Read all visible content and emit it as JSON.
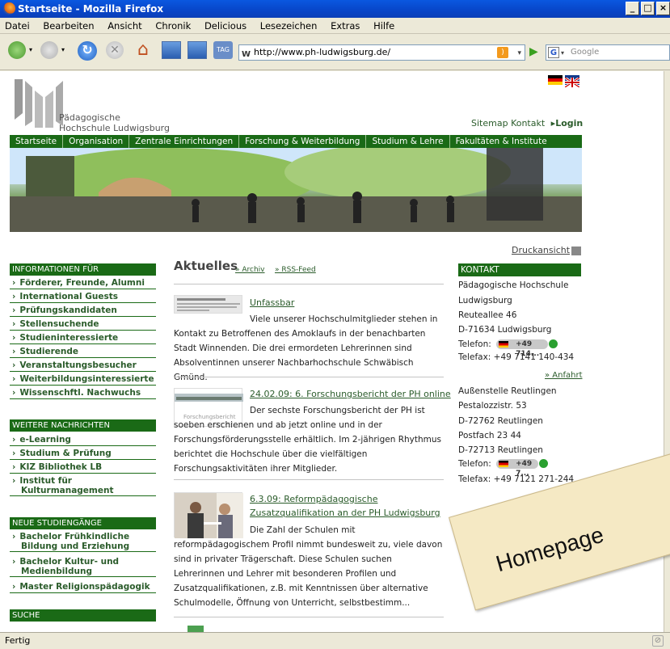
{
  "window": {
    "title": "Startseite - Mozilla Firefox"
  },
  "menu": {
    "items": [
      "Datei",
      "Bearbeiten",
      "Ansicht",
      "Chronik",
      "Delicious",
      "Lesezeichen",
      "Extras",
      "Hilfe"
    ]
  },
  "toolbar": {
    "url": "http://www.ph-ludwigsburg.de/",
    "search_placeholder": "Google"
  },
  "status": {
    "text": "Fertig"
  },
  "site": {
    "logo_line1": "Pädagogische",
    "logo_line2": "Hochschule Ludwigsburg",
    "toplinks": {
      "sitemap": "Sitemap",
      "kontakt": "Kontakt",
      "login": "Login"
    },
    "mainnav": [
      "Startseite",
      "Organisation",
      "Zentrale Einrichtungen",
      "Forschung & Weiterbildung",
      "Studium & Lehre",
      "Fakultäten & Institute"
    ],
    "druckansicht": "Druckansicht"
  },
  "sidebar": {
    "info_head": "INFORMATIONEN FÜR",
    "info_items": [
      "Förderer, Freunde, Alumni",
      "International Guests",
      "Prüfungskandidaten",
      "Stellensuchende",
      "Studieninteressierte",
      "Studierende",
      "Veranstaltungsbesucher",
      "Weiterbildungsinteressierte",
      "Wissenschftl. Nachwuchs"
    ],
    "weitere_head": "WEITERE NACHRICHTEN",
    "weitere_items": [
      "e-Learning",
      "Studium & Prüfung",
      "KIZ Bibliothek LB",
      "Institut für Kulturmanagement"
    ],
    "neue_head": "NEUE STUDIENGÄNGE",
    "neue_items": [
      "Bachelor Frühkindliche Bildung und Erziehung",
      "Bachelor Kultur- und Medienbildung",
      "Master Religionspädagogik"
    ],
    "suche_head": "SUCHE"
  },
  "news": {
    "title": "Aktuelles",
    "archiv": "» Archiv",
    "rss": "» RSS-Feed",
    "items": [
      {
        "title": "Unfassbar",
        "body": "Viele unserer Hochschulmitglieder stehen in Kontakt zu Betroffenen des Amoklaufs in der benachbarten Stadt Winnenden. Die drei ermordeten Lehrerinnen sind Absolventinnen unserer Nachbarhochschule Schwäbisch Gmünd."
      },
      {
        "title": "24.02.09: 6. Forschungsbericht der PH online",
        "body": "Der sechste Forschungsbericht der PH ist soeben erschienen und ab jetzt online und in der Forschungsförderungsstelle erhältlich. Im 2-jährigen Rhythmus berichtet die Hochschule über die vielfältigen Forschungsaktivitäten ihrer Mitglieder."
      },
      {
        "title": "6.3.09: Reformpädagogische Zusatzqualifikation an der PH Ludwigsburg",
        "body": "Die Zahl der Schulen mit reformpädagogischem Profil nimmt bundesweit zu, viele davon sind in privater Trägerschaft. Diese Schulen suchen Lehrerinnen und Lehrer mit besonderen Profilen und Zusatzqualifikationen, z.B. mit Kenntnissen über alternative Schulmodelle, Öffnung von Unterricht, selbstbestimm..."
      }
    ]
  },
  "kontakt": {
    "head": "KONTAKT",
    "main": [
      "Pädagogische Hochschule",
      "Ludwigsburg",
      "Reuteallee 46",
      "D-71634 Ludwigsburg"
    ],
    "main_tel_label": "Telefon:",
    "main_tel": "+49 714...",
    "main_fax": "Telefax: +49 7141 140-434",
    "anfahrt": "» Anfahrt",
    "reut": [
      "Außenstelle Reutlingen",
      "Pestalozzistr. 53",
      "D-72762 Reutlingen",
      "Postfach 23 44",
      "D-72713 Reutlingen"
    ],
    "reut_tel_label": "Telefon:",
    "reut_tel": "+49 7...",
    "reut_fax": "Telefax: +49 7121 271-244"
  },
  "overlay": {
    "label": "Homepage"
  },
  "colors": {
    "accent": "#1a6a16",
    "link": "#2b5c2b"
  }
}
